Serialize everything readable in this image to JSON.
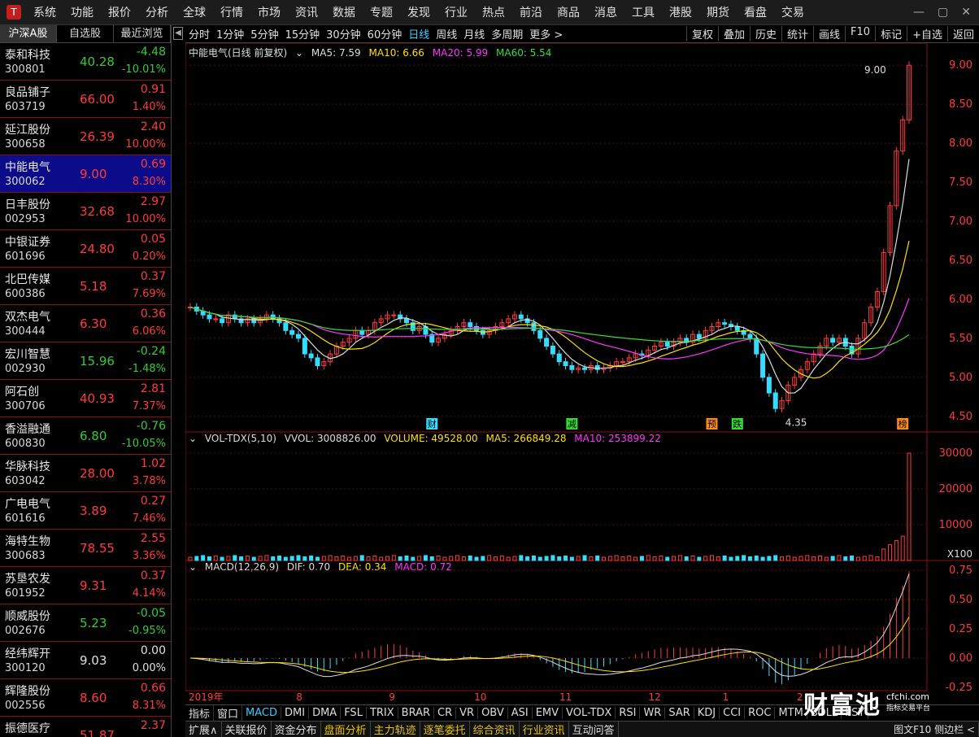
{
  "menu": [
    "系统",
    "功能",
    "报价",
    "分析",
    "全球",
    "行情",
    "市场",
    "资讯",
    "数据",
    "专题",
    "发现",
    "行业",
    "热点",
    "前沿",
    "商品",
    "消息",
    "工具",
    "港股",
    "期货",
    "看盘",
    "交易"
  ],
  "left_tabs": [
    "沪深A股",
    "自选股",
    "最近浏览"
  ],
  "stocks": [
    {
      "name": "泰和科技",
      "code": "300801",
      "price": "40.28",
      "change": "-4.48",
      "pct": "-10.01%",
      "dir": "dn"
    },
    {
      "name": "良品铺子",
      "code": "603719",
      "price": "66.00",
      "change": "0.91",
      "pct": "1.40%",
      "dir": "up"
    },
    {
      "name": "延江股份",
      "code": "300658",
      "price": "26.39",
      "change": "2.40",
      "pct": "10.00%",
      "dir": "up"
    },
    {
      "name": "中能电气",
      "code": "300062",
      "price": "9.00",
      "change": "0.69",
      "pct": "8.30%",
      "dir": "up",
      "selected": true
    },
    {
      "name": "日丰股份",
      "code": "002953",
      "price": "32.68",
      "change": "2.97",
      "pct": "10.00%",
      "dir": "up"
    },
    {
      "name": "中银证券",
      "code": "601696",
      "price": "24.80",
      "change": "0.05",
      "pct": "0.20%",
      "dir": "up"
    },
    {
      "name": "北巴传媒",
      "code": "600386",
      "price": "5.18",
      "change": "0.37",
      "pct": "7.69%",
      "dir": "up"
    },
    {
      "name": "双杰电气",
      "code": "300444",
      "price": "6.30",
      "change": "0.36",
      "pct": "6.06%",
      "dir": "up"
    },
    {
      "name": "宏川智慧",
      "code": "002930",
      "price": "15.96",
      "change": "-0.24",
      "pct": "-1.48%",
      "dir": "dn"
    },
    {
      "name": "阿石创",
      "code": "300706",
      "price": "40.93",
      "change": "2.81",
      "pct": "7.37%",
      "dir": "up"
    },
    {
      "name": "香溢融通",
      "code": "600830",
      "price": "6.80",
      "change": "-0.76",
      "pct": "-10.05%",
      "dir": "dn"
    },
    {
      "name": "华脉科技",
      "code": "603042",
      "price": "28.00",
      "change": "1.02",
      "pct": "3.78%",
      "dir": "up"
    },
    {
      "name": "广电电气",
      "code": "601616",
      "price": "3.89",
      "change": "0.27",
      "pct": "7.46%",
      "dir": "up"
    },
    {
      "name": "海特生物",
      "code": "300683",
      "price": "78.55",
      "change": "2.55",
      "pct": "3.36%",
      "dir": "up"
    },
    {
      "name": "苏垦农发",
      "code": "601952",
      "price": "9.31",
      "change": "0.37",
      "pct": "4.14%",
      "dir": "up"
    },
    {
      "name": "顺威股份",
      "code": "002676",
      "price": "5.23",
      "change": "-0.05",
      "pct": "-0.95%",
      "dir": "dn"
    },
    {
      "name": "经纬辉开",
      "code": "300120",
      "price": "9.03",
      "change": "0.00",
      "pct": "0.00%",
      "dir": "wh"
    },
    {
      "name": "辉隆股份",
      "code": "002556",
      "price": "8.60",
      "change": "0.66",
      "pct": "8.31%",
      "dir": "up"
    },
    {
      "name": "振德医疗",
      "code": "",
      "price": "51.87",
      "change": "2.37",
      "pct": "",
      "dir": "up"
    }
  ],
  "toolbar": {
    "periods": [
      "分时",
      "1分钟",
      "5分钟",
      "15分钟",
      "30分钟",
      "60分钟",
      "日线",
      "周线",
      "月线",
      "多周期",
      "更多 >"
    ],
    "active": "日线",
    "right": [
      "复权",
      "叠加",
      "历史",
      "统计",
      "画线",
      "F10",
      "标记",
      "+自选",
      "返回"
    ]
  },
  "main_legend": {
    "title": "中能电气(日线 前复权)",
    "ma5": "MA5: 7.59",
    "ma10": "MA10: 6.66",
    "ma20": "MA20: 5.99",
    "ma60": "MA60: 5.54"
  },
  "vol_legend": {
    "title": "VOL-TDX(5,10)",
    "vvol": "VVOL: 3008826.00",
    "volume": "VOLUME: 49528.00",
    "ma5": "MA5: 266849.28",
    "ma10": "MA10: 253899.22"
  },
  "macd_legend": {
    "title": "MACD(12,26,9)",
    "dif": "DIF: 0.70",
    "dea": "DEA: 0.34",
    "macd": "MACD: 0.72"
  },
  "price_axis": [
    "9.00",
    "8.50",
    "8.00",
    "7.50",
    "7.00",
    "6.50",
    "6.00",
    "5.50",
    "5.00",
    "4.50"
  ],
  "vol_axis": [
    "30000",
    "20000",
    "10000",
    "X100"
  ],
  "macd_axis": [
    "0.75",
    "0.50",
    "0.25",
    "0.00",
    "-0.25"
  ],
  "date_axis": [
    "2019年",
    "8",
    "9",
    "10",
    "11",
    "12",
    "1",
    "2"
  ],
  "annotations": {
    "high": "9.00",
    "low": "4.35",
    "markers": [
      "财",
      "减",
      "预",
      "跌",
      "榜"
    ]
  },
  "bottom_indicators": [
    "指标",
    "窗口",
    "MACD",
    "DMI",
    "DMA",
    "FSL",
    "TRIX",
    "BRAR",
    "CR",
    "VR",
    "OBV",
    "ASI",
    "EMV",
    "VOL-TDX",
    "RSI",
    "WR",
    "SAR",
    "KDJ",
    "CCI",
    "ROC",
    "MTM",
    "BOLL",
    "PSY"
  ],
  "bottom_tabs": [
    "扩展∧",
    "关联报价",
    "资金分布",
    "盘面分析",
    "主力轨迹",
    "逐笔委托",
    "综合资讯",
    "行业资讯",
    "互动问答"
  ],
  "bottom_right": "图文F10 侧边栏 <",
  "watermark": {
    "title": "财富池",
    "url": "cfchi.com",
    "slogan": "指标交易平台"
  },
  "chart_data": {
    "type": "candlestick",
    "title": "中能电气(日线 前复权)",
    "ylim": [
      4.3,
      9.2
    ],
    "x_labels": [
      "2019年",
      "8",
      "9",
      "10",
      "11",
      "12",
      "1",
      "2"
    ],
    "ohlc_approx": {
      "start_close": 5.95,
      "low": 4.35,
      "high": 9.0,
      "last_close": 9.0
    },
    "ma": {
      "MA5": 7.59,
      "MA10": 6.66,
      "MA20": 5.99,
      "MA60": 5.54
    },
    "closes": [
      5.9,
      5.85,
      5.8,
      5.75,
      5.75,
      5.7,
      5.8,
      5.75,
      5.7,
      5.75,
      5.7,
      5.75,
      5.8,
      5.75,
      5.7,
      5.6,
      5.55,
      5.5,
      5.3,
      5.25,
      5.15,
      5.2,
      5.3,
      5.4,
      5.45,
      5.5,
      5.6,
      5.55,
      5.6,
      5.7,
      5.75,
      5.8,
      5.8,
      5.75,
      5.7,
      5.6,
      5.65,
      5.55,
      5.45,
      5.5,
      5.55,
      5.6,
      5.65,
      5.7,
      5.65,
      5.6,
      5.55,
      5.6,
      5.65,
      5.7,
      5.75,
      5.8,
      5.75,
      5.7,
      5.6,
      5.5,
      5.4,
      5.3,
      5.2,
      5.15,
      5.1,
      5.12,
      5.1,
      5.15,
      5.1,
      5.12,
      5.15,
      5.2,
      5.2,
      5.25,
      5.3,
      5.28,
      5.35,
      5.4,
      5.45,
      5.4,
      5.45,
      5.5,
      5.45,
      5.55,
      5.5,
      5.6,
      5.65,
      5.7,
      5.68,
      5.65,
      5.6,
      5.55,
      5.5,
      5.3,
      5.0,
      4.8,
      4.6,
      4.7,
      4.9,
      5.0,
      5.1,
      5.2,
      5.3,
      5.4,
      5.5,
      5.45,
      5.5,
      5.4,
      5.3,
      5.5,
      5.7,
      5.9,
      6.1,
      6.6,
      7.2,
      7.9,
      8.3,
      9.0
    ],
    "volume_approx": {
      "max": 30000,
      "last": 30000
    }
  }
}
